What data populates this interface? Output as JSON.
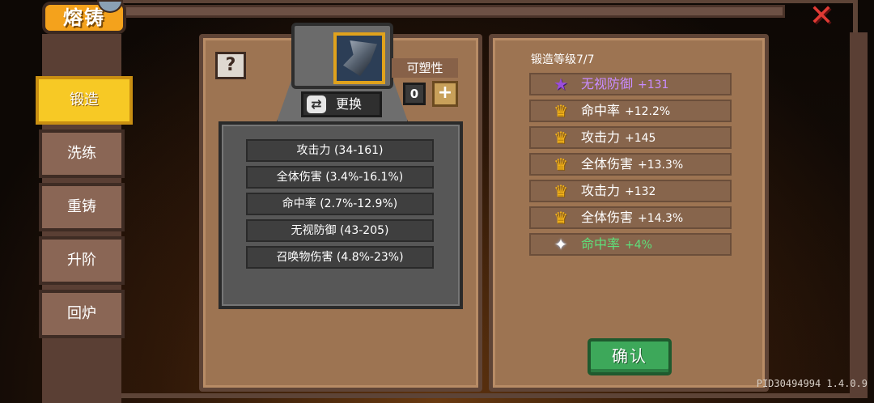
{
  "header": {
    "title": "熔铸",
    "close_symbol": "✕"
  },
  "sidebar": {
    "items": [
      {
        "label": "锻造",
        "active": true
      },
      {
        "label": "洗练",
        "active": false
      },
      {
        "label": "重铸",
        "active": false
      },
      {
        "label": "升阶",
        "active": false
      },
      {
        "label": "回炉",
        "active": false
      }
    ]
  },
  "equipment": {
    "help_symbol": "?",
    "swap_label": "更换",
    "swap_icon": "⇄",
    "plasticity_label": "可塑性",
    "plasticity_value": "0",
    "plus_symbol": "+",
    "stats": [
      "攻击力 (34-161)",
      "全体伤害 (3.4%-16.1%)",
      "命中率 (2.7%-12.9%)",
      "无视防御 (43-205)",
      "召唤物伤害 (4.8%-23%)"
    ]
  },
  "forge": {
    "level_label": "锻造等级7/7",
    "bonuses": [
      {
        "icon": "star-icon",
        "glyph": "★",
        "name": "无视防御",
        "value": "+131",
        "color": "#c98cff"
      },
      {
        "icon": "crown-icon",
        "glyph": "♛",
        "name": "命中率",
        "value": "+12.2%",
        "color": "#ffffff"
      },
      {
        "icon": "crown-icon",
        "glyph": "♛",
        "name": "攻击力",
        "value": "+145",
        "color": "#ffffff"
      },
      {
        "icon": "crown-icon",
        "glyph": "♛",
        "name": "全体伤害",
        "value": "+13.3%",
        "color": "#ffffff"
      },
      {
        "icon": "crown-icon",
        "glyph": "♛",
        "name": "攻击力",
        "value": "+132",
        "color": "#ffffff"
      },
      {
        "icon": "crown-icon",
        "glyph": "♛",
        "name": "全体伤害",
        "value": "+14.3%",
        "color": "#ffffff"
      },
      {
        "icon": "spark-icon",
        "glyph": "✦",
        "name": "命中率",
        "value": "+4%",
        "color": "#5ee07a"
      }
    ],
    "confirm_label": "确认"
  },
  "footer": {
    "pid_version": "PID30494994 1.4.0.9"
  },
  "colors": {
    "accent_yellow": "#f7c925",
    "panel_brown": "#9d7452",
    "confirm_green": "#3da85a",
    "close_red": "#e03a34"
  }
}
